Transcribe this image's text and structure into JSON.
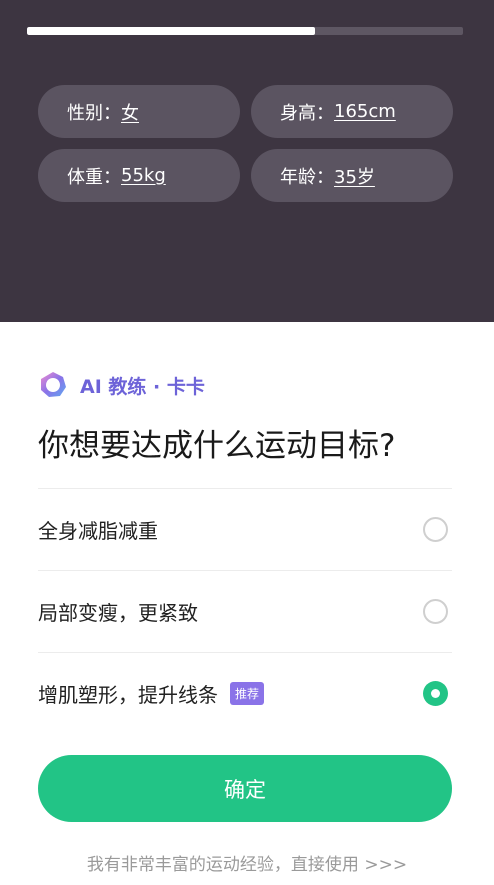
{
  "progress": {
    "fraction": 0.66
  },
  "profile": {
    "gender": {
      "label": "性别：",
      "value": "女"
    },
    "height": {
      "label": "身高：",
      "value": "165cm"
    },
    "weight": {
      "label": "体重：",
      "value": "55kg"
    },
    "age": {
      "label": "年龄：",
      "value": "35岁"
    }
  },
  "coach": {
    "name": "AI 教练 · 卡卡",
    "logo_icon": "ai-coach-logo-icon"
  },
  "question": "你想要达成什么运动目标?",
  "options": [
    {
      "label": "全身减脂减重",
      "selected": false
    },
    {
      "label": "局部变瘦，更紧致",
      "selected": false
    },
    {
      "label": "增肌塑形，提升线条",
      "tag": "推荐",
      "selected": true
    }
  ],
  "confirm_label": "确定",
  "skip_label": "我有非常丰富的运动经验，直接使用 >>>",
  "colors": {
    "accent": "#22c486",
    "header_bg": "#3d3541",
    "chip_bg": "#5b5461",
    "coach": "#6d63d8",
    "tag": "#8a73e8"
  }
}
